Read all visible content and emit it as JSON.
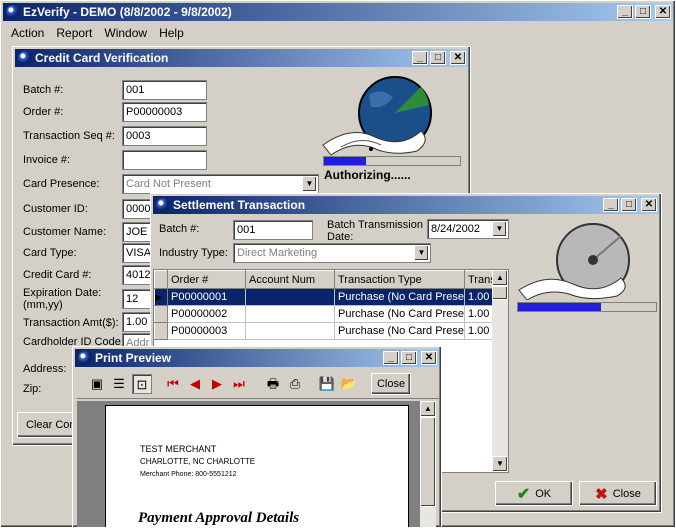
{
  "app": {
    "title": "EzVerify - DEMO (8/8/2002 - 9/8/2002)",
    "menu": [
      "Action",
      "Report",
      "Window",
      "Help"
    ]
  },
  "ccv": {
    "title": "Credit Card Verification",
    "labels": {
      "batch": "Batch #:",
      "order": "Order #:",
      "seq": "Transaction Seq #:",
      "invoice": "Invoice #:",
      "presence": "Card Presence:",
      "customer_id": "Customer ID:",
      "customer_name": "Customer Name:",
      "card_type": "Card Type:",
      "card_no": "Credit Card #:",
      "expiration": "Expiration Date:\n(mm,yy)",
      "amount": "Transaction Amt($):",
      "cardholder": "Cardholder ID Code:",
      "address": "Address:",
      "zip": "Zip:"
    },
    "values": {
      "batch": "001",
      "order": "P00000003",
      "seq": "0003",
      "invoice": "",
      "presence": "Card Not Present",
      "customer_id": "0000",
      "customer_name": "JOE",
      "card_type": "VISA",
      "card_no": "4012",
      "expiration": "12",
      "amount": "1.00",
      "cardholder": "Addr"
    },
    "status": "Authorizing......",
    "progress": 0.31,
    "clear_label": "Clear Con"
  },
  "settle": {
    "title": "Settlement Transaction",
    "batch_label": "Batch #:",
    "batch_value": "001",
    "transmission_label": "Batch Transmission\nDate:",
    "transmission_value": "8/24/2002",
    "industry_label": "Industry Type:",
    "industry_value": "Direct Marketing",
    "progress": 0.6,
    "columns": [
      "Order #",
      "Account Num",
      "Transaction Type",
      "Trans"
    ],
    "rows": [
      {
        "order": "P00000001",
        "account": "",
        "type": "Purchase (No Card Present)",
        "amount": "1.00"
      },
      {
        "order": "P00000002",
        "account": "",
        "type": "Purchase (No Card Present)",
        "amount": "1.00"
      },
      {
        "order": "P00000003",
        "account": "",
        "type": "Purchase (No Card Present)",
        "amount": "1.00"
      }
    ],
    "ok_label": "OK",
    "close_label": "Close"
  },
  "preview": {
    "title": "Print Preview",
    "close_label": "Close",
    "doc": {
      "merchant": "TEST MERCHANT",
      "city": "CHARLOTTE, NC CHARLOTTE",
      "phone": "Merchant Phone: 800-5551212",
      "heading": "Payment Approval Details"
    }
  },
  "colors": {
    "titlebar": "#0a246a",
    "progress": "#1e1edc",
    "selected_row": "#0a246a"
  }
}
